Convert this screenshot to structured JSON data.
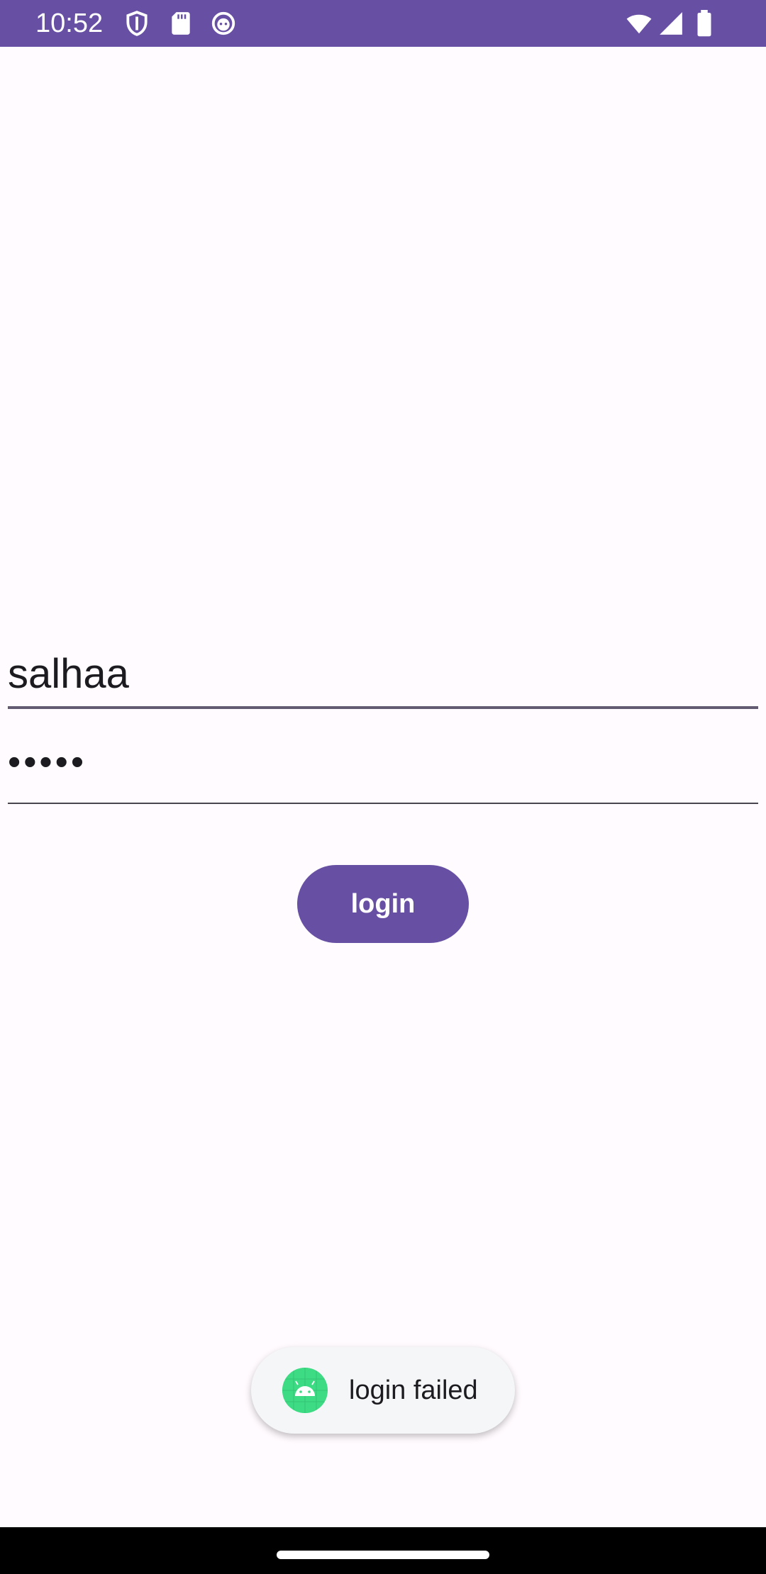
{
  "status_bar": {
    "time": "10:52",
    "left_icons": [
      "shield-icon",
      "sd-card-icon",
      "cat-face-icon"
    ],
    "right_icons": [
      "wifi-icon",
      "cell-signal-icon",
      "battery-icon"
    ],
    "background": "#6750a4"
  },
  "login_form": {
    "username_value": "salhaa",
    "password_value": "•••••",
    "login_label": "login",
    "accent_color": "#6750a4"
  },
  "toast": {
    "icon": "android-icon",
    "message": "login failed"
  },
  "nav_bar": {
    "handle": "home-handle"
  }
}
